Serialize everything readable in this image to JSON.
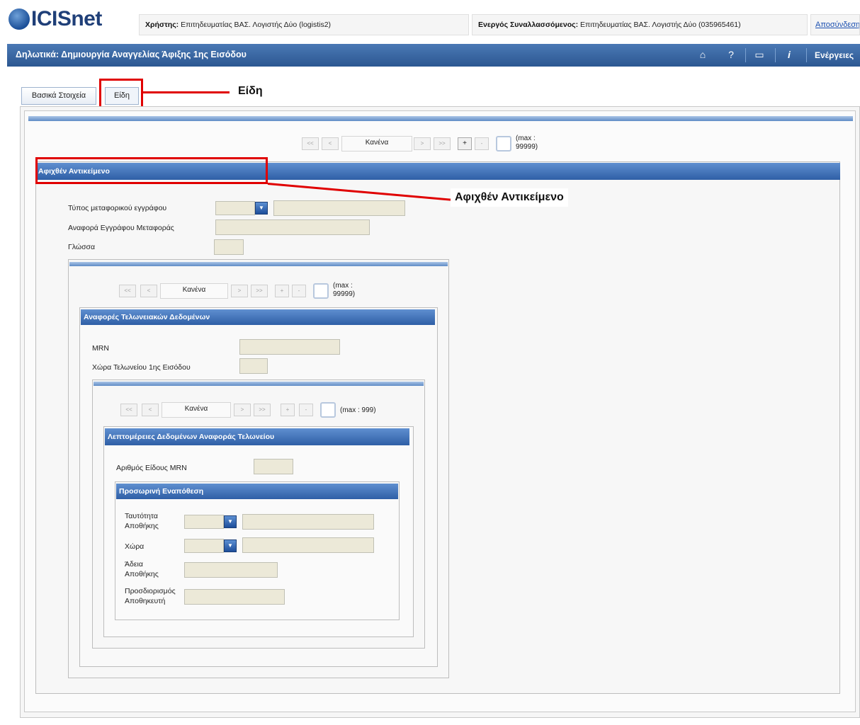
{
  "header": {
    "logo": "ICISnet",
    "user_label": "Χρήστης:",
    "user_value": "Επιτηδευματίας ΒΑΣ. Λογιστής Δύο (logistis2)",
    "trader_label": "Ενεργός Συναλλασσόμενος:",
    "trader_value": "Επιτηδευματίας ΒΑΣ. Λογιστής Δύο (035965461)",
    "logout_link": "Αποσύνδεση"
  },
  "titlebar": {
    "title": "Δηλωτικά: Δημιουργία Αναγγελίας Άφιξης 1ης Εισόδου",
    "actions_label": "Ενέργειες",
    "icons": [
      "home-icon",
      "help-icon",
      "window-icon",
      "info-icon"
    ]
  },
  "tabs": [
    {
      "label": "Βασικά Στοιχεία"
    },
    {
      "label": "Είδη"
    }
  ],
  "annotations": {
    "tab_callout": "Είδη",
    "section_callout": "Αφιχθέν Αντικείμενο"
  },
  "navigators": {
    "first": "<<",
    "prev": "<",
    "next": ">",
    "last": ">>",
    "add": "+",
    "remove": "-",
    "none_text": "Κανένα",
    "max_99999": "(max : 99999)",
    "max_999": "(max : 999)"
  },
  "arrived_item": {
    "header": "Αφιχθέν Αντικείμενο",
    "transport_doc_type_label": "Τύπος μεταφορικού εγγράφου",
    "transport_doc_ref_label": "Αναφορά Εγγράφου Μεταφοράς",
    "language_label": "Γλώσσα"
  },
  "customs_refs": {
    "header": "Αναφορές Τελωνειακών Δεδομένων",
    "mrn_label": "MRN",
    "country_label": "Χώρα Τελωνείου 1ης Εισόδου"
  },
  "customs_details": {
    "header": "Λεπτομέρειες Δεδομένων Αναφοράς Τελωνείου",
    "item_number_label": "Αριθμός Είδους MRN"
  },
  "temp_storage": {
    "header": "Προσωρινή Εναπόθεση",
    "storage_id_label": "Ταυτότητα Αποθήκης",
    "country_label": "Χώρα",
    "license_label": "Άδεια Αποθήκης",
    "keeper_id_label": "Προσδιορισμός Αποθηκευτή"
  },
  "colors": {
    "accent": "#2c5791",
    "callout_red": "#e00000",
    "field_bg": "#ece9d8"
  }
}
